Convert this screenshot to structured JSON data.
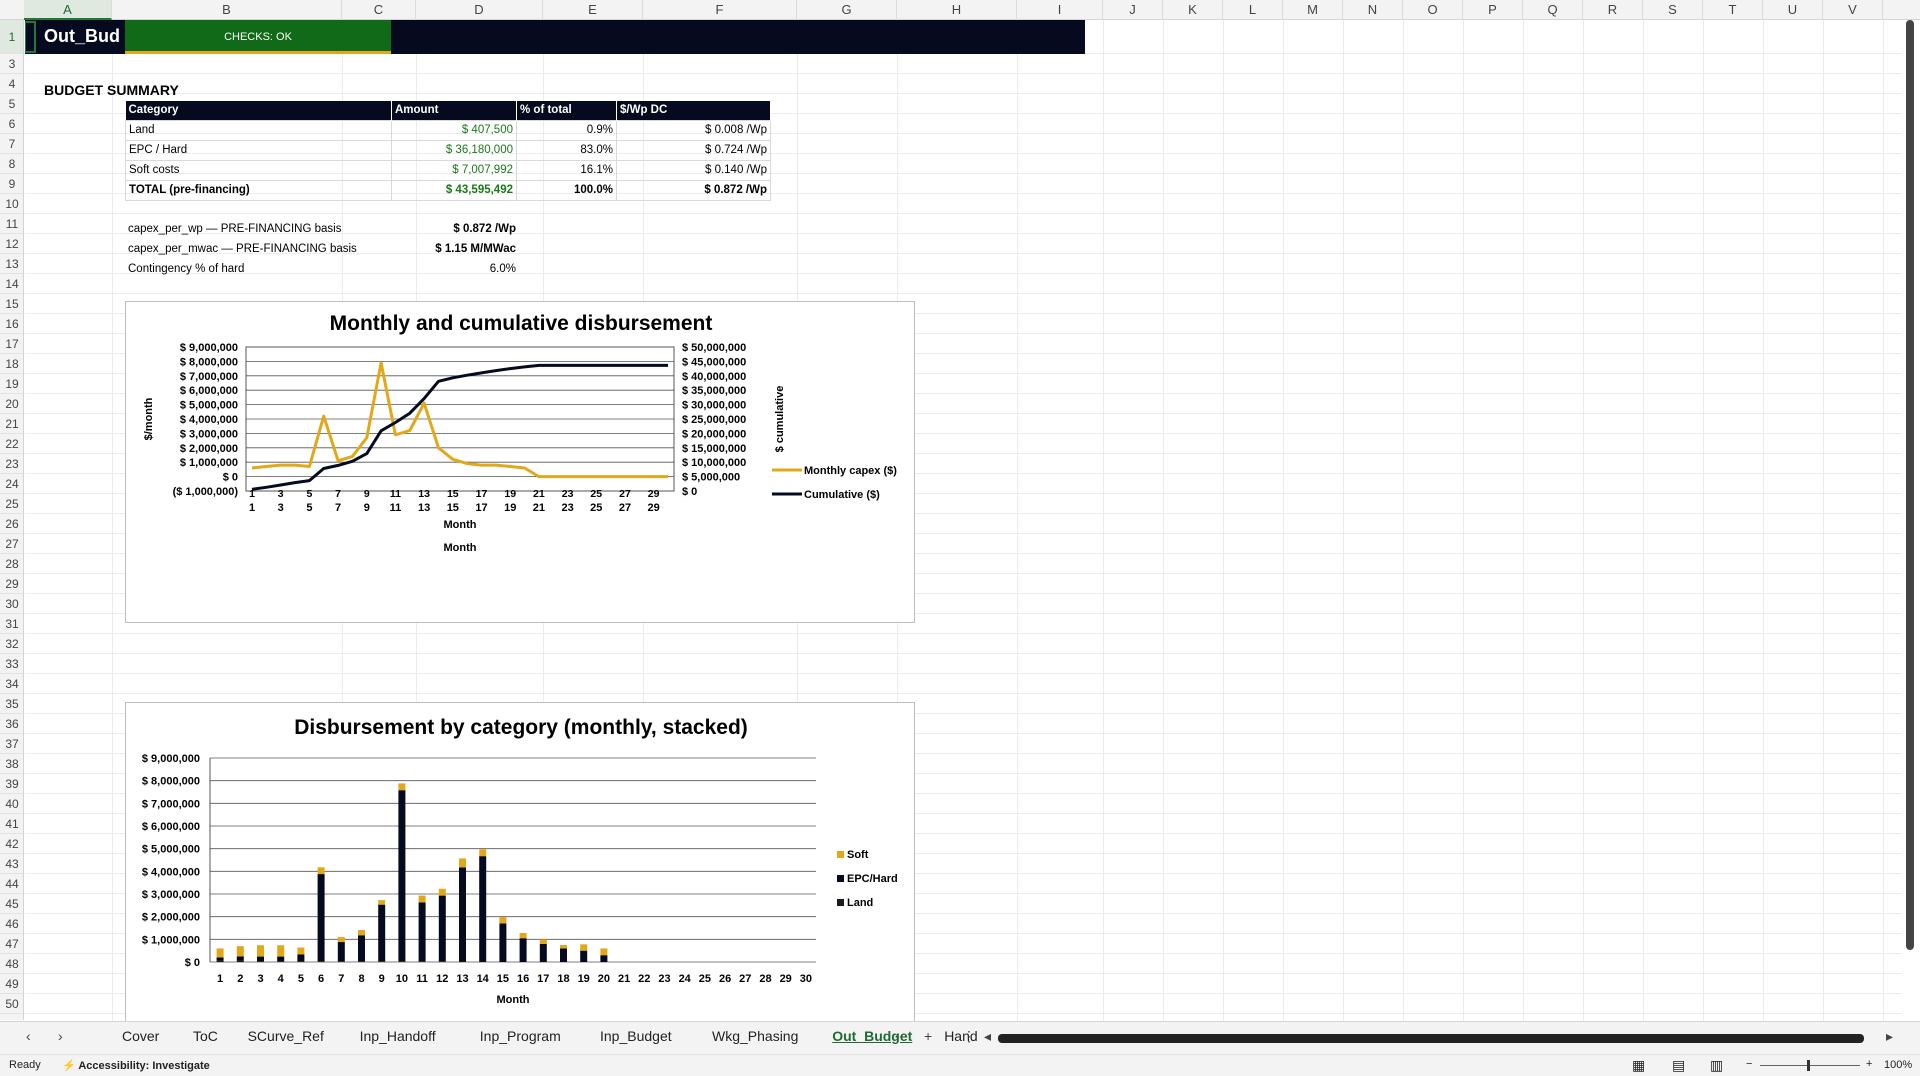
{
  "columns": [
    "A",
    "B",
    "C",
    "D",
    "E",
    "F",
    "G",
    "H",
    "I",
    "J",
    "K",
    "L",
    "M",
    "N",
    "O",
    "P",
    "Q",
    "R",
    "S",
    "T",
    "U",
    "V"
  ],
  "selected_column": "A",
  "rows": [
    "1",
    "3",
    "4",
    "5",
    "6",
    "7",
    "8",
    "9",
    "10",
    "11",
    "12",
    "13",
    "14",
    "15",
    "16",
    "17",
    "18",
    "19",
    "20",
    "21",
    "22",
    "23",
    "24",
    "25",
    "26",
    "27",
    "28",
    "29",
    "30",
    "31",
    "32",
    "33",
    "34",
    "35",
    "36",
    "37",
    "38",
    "39",
    "40",
    "41",
    "42",
    "43",
    "44",
    "45",
    "46",
    "47",
    "48",
    "49",
    "50"
  ],
  "header": {
    "title": "Out_Bud",
    "checks": "CHECKS: OK"
  },
  "summary": {
    "title": "BUDGET SUMMARY",
    "columns": [
      "Category",
      "Amount",
      "% of total",
      "$/Wp DC"
    ],
    "rows": [
      [
        "Land",
        "$ 407,500",
        "0.9%",
        "$ 0.008 /Wp"
      ],
      [
        "EPC / Hard",
        "$ 36,180,000",
        "83.0%",
        "$ 0.724 /Wp"
      ],
      [
        "Soft costs",
        "$ 7,007,992",
        "16.1%",
        "$ 0.140 /Wp"
      ],
      [
        "TOTAL (pre-financing)",
        "$ 43,595,492",
        "100.0%",
        "$ 0.872 /Wp"
      ]
    ]
  },
  "metrics": [
    {
      "label": "capex_per_wp — PRE-FINANCING basis",
      "value": "$ 0.872 /Wp"
    },
    {
      "label": "capex_per_mwac — PRE-FINANCING basis",
      "value": "$ 1.15 M/MWac"
    },
    {
      "label": "Contingency % of hard",
      "value": "6.0%"
    }
  ],
  "colors": {
    "navy": "#050a1e",
    "gold": "#e3a81a",
    "green": "#116a17"
  },
  "chart_data": [
    {
      "type": "line",
      "title": "Monthly and cumulative disbursement",
      "xlabel": "Month",
      "xlabel2": "Month",
      "ylabel": "$/month",
      "y2label": "$ cumulative",
      "x": [
        1,
        2,
        3,
        4,
        5,
        6,
        7,
        8,
        9,
        10,
        11,
        12,
        13,
        14,
        15,
        16,
        17,
        18,
        19,
        20,
        21,
        22,
        23,
        24,
        25,
        26,
        27,
        28,
        29,
        30
      ],
      "x_ticks": [
        "1",
        "3",
        "5",
        "7",
        "9",
        "11",
        "13",
        "15",
        "17",
        "19",
        "21",
        "23",
        "25",
        "27",
        "29"
      ],
      "ylim": [
        -1000000,
        9000000
      ],
      "y_ticks": [
        "($ 1,000,000)",
        "$ 0",
        "$ 1,000,000",
        "$ 2,000,000",
        "$ 3,000,000",
        "$ 4,000,000",
        "$ 5,000,000",
        "$ 6,000,000",
        "$ 7,000,000",
        "$ 8,000,000",
        "$ 9,000,000"
      ],
      "y2lim": [
        0,
        50000000
      ],
      "y2_ticks": [
        "$ 0",
        "$ 5,000,000",
        "$ 10,000,000",
        "$ 15,000,000",
        "$ 20,000,000",
        "$ 25,000,000",
        "$ 30,000,000",
        "$ 35,000,000",
        "$ 40,000,000",
        "$ 45,000,000",
        "$ 50,000,000"
      ],
      "series": [
        {
          "name": "Monthly capex ($)",
          "axis": "left",
          "color": "#e3a81a",
          "values": [
            600000,
            700000,
            800000,
            800000,
            700000,
            4200000,
            1100000,
            1400000,
            2700000,
            7900000,
            2900000,
            3200000,
            5100000,
            2000000,
            1200000,
            900000,
            800000,
            800000,
            700000,
            600000,
            0,
            0,
            0,
            0,
            0,
            0,
            0,
            0,
            0,
            0
          ]
        },
        {
          "name": "Cumulative ($)",
          "axis": "right",
          "color": "#050a1e",
          "values": [
            600000,
            1300000,
            2100000,
            2900000,
            3600000,
            7800000,
            8900000,
            10300000,
            13000000,
            20900000,
            23800000,
            27000000,
            32100000,
            38100000,
            39300000,
            40200000,
            41000000,
            41800000,
            42500000,
            43100000,
            43600000,
            43600000,
            43600000,
            43600000,
            43600000,
            43600000,
            43600000,
            43600000,
            43600000,
            43600000
          ]
        }
      ],
      "legend": "right"
    },
    {
      "type": "bar",
      "stacked": true,
      "title": "Disbursement by category (monthly, stacked)",
      "xlabel": "Month",
      "categories": [
        "1",
        "2",
        "3",
        "4",
        "5",
        "6",
        "7",
        "8",
        "9",
        "10",
        "11",
        "12",
        "13",
        "14",
        "15",
        "16",
        "17",
        "18",
        "19",
        "20",
        "21",
        "22",
        "23",
        "24",
        "25",
        "26",
        "27",
        "28",
        "29",
        "30"
      ],
      "ylim": [
        0,
        9000000
      ],
      "y_ticks": [
        "$ 0",
        "$ 1,000,000",
        "$ 2,000,000",
        "$ 3,000,000",
        "$ 4,000,000",
        "$ 5,000,000",
        "$ 6,000,000",
        "$ 7,000,000",
        "$ 8,000,000",
        "$ 9,000,000"
      ],
      "series": [
        {
          "name": "Land",
          "color": "#1a1a1a",
          "values": [
            50000,
            50000,
            40000,
            40000,
            40000,
            30000,
            30000,
            30000,
            30000,
            30000,
            30000,
            30000,
            20000,
            20000,
            0,
            0,
            0,
            0,
            0,
            0,
            0,
            0,
            0,
            0,
            0,
            0,
            0,
            0,
            0,
            0
          ]
        },
        {
          "name": "EPC/Hard",
          "color": "#050a1e",
          "values": [
            150000,
            200000,
            200000,
            200000,
            300000,
            3850000,
            850000,
            1150000,
            2500000,
            7550000,
            2600000,
            2900000,
            4150000,
            4650000,
            1700000,
            1050000,
            800000,
            600000,
            500000,
            300000,
            0,
            0,
            0,
            0,
            0,
            0,
            0,
            0,
            0,
            0
          ]
        },
        {
          "name": "Soft",
          "color": "#e3a81a",
          "values": [
            400000,
            450000,
            500000,
            500000,
            300000,
            300000,
            220000,
            230000,
            200000,
            300000,
            300000,
            300000,
            400000,
            300000,
            280000,
            230000,
            200000,
            150000,
            280000,
            300000,
            0,
            0,
            0,
            0,
            0,
            0,
            0,
            0,
            0,
            0
          ]
        }
      ],
      "legend": "right"
    }
  ],
  "tabs": [
    "Cover",
    "ToC",
    "SCurve_Ref",
    "Inp_Handoff",
    "Inp_Program",
    "Inp_Budget",
    "Wkg_Phasing",
    "Out_Budget",
    "Hand"
  ],
  "active_tab": "Out_Budget",
  "status": {
    "ready": "Ready",
    "accessibility": "Accessibility: Investigate",
    "zoom": "100%"
  }
}
